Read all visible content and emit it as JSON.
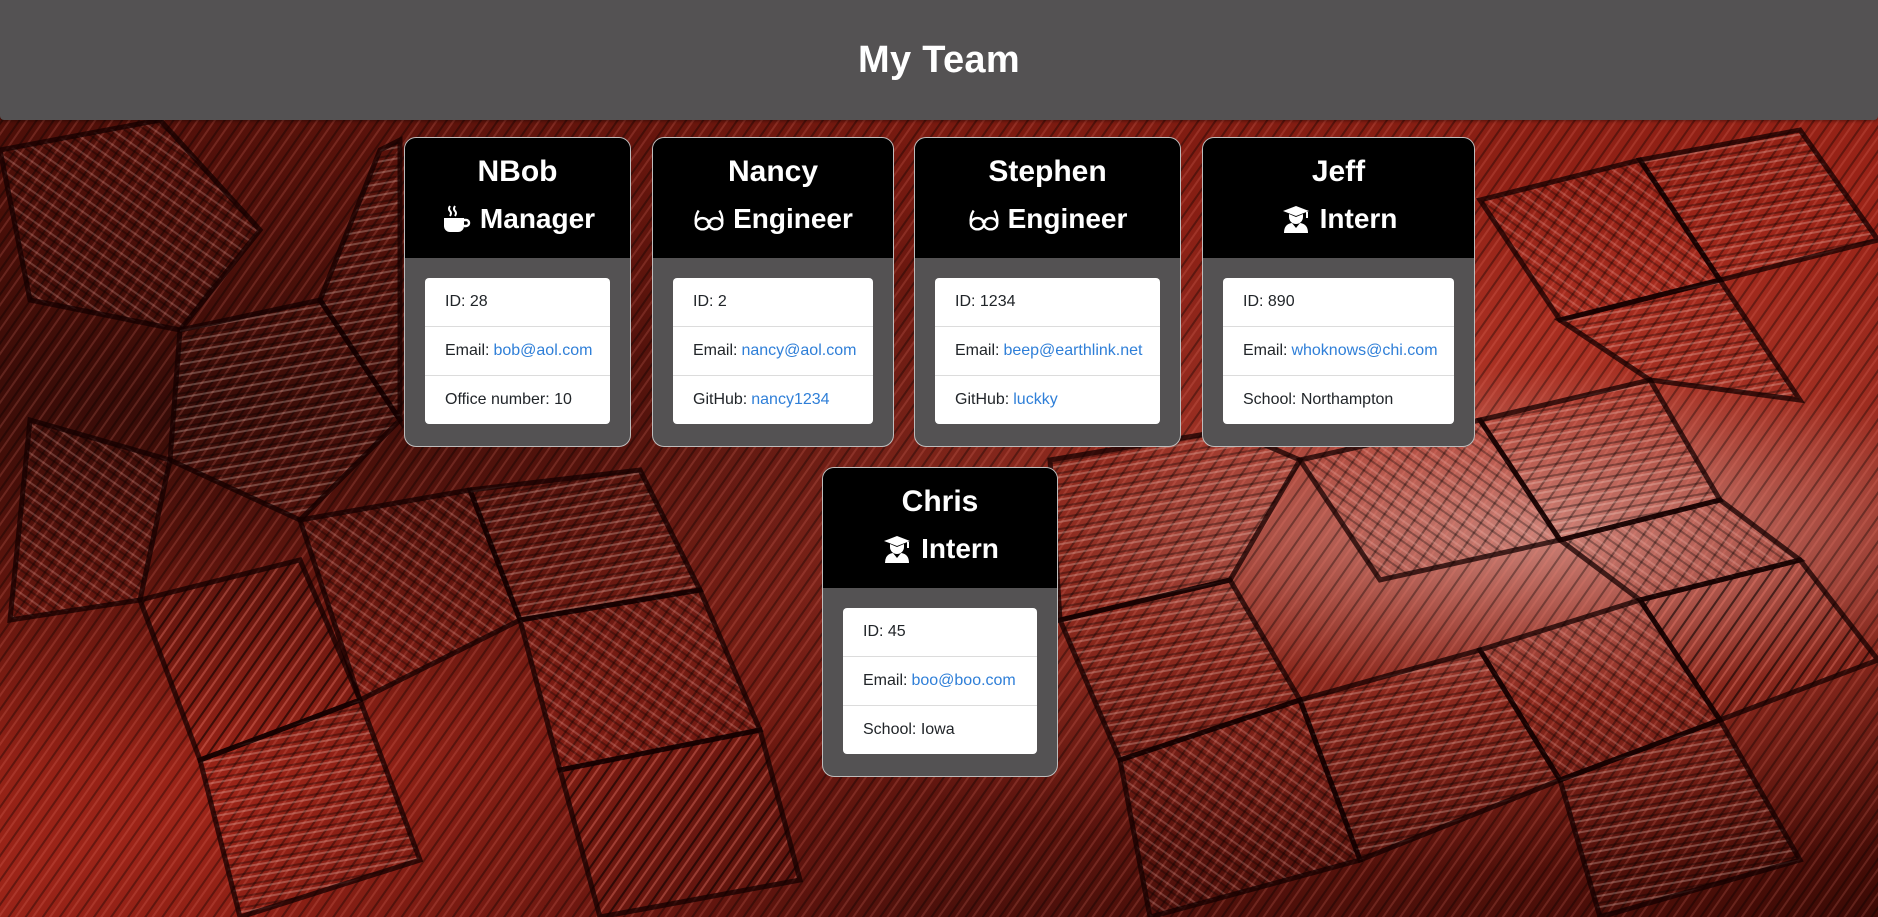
{
  "header": {
    "title": "My Team"
  },
  "colors": {
    "header_bg": "#545253",
    "card_head_bg": "#000000",
    "link": "#2f7fd8",
    "background_accent": "#9c2418"
  },
  "employees": [
    {
      "name": "NBob",
      "role": "Manager",
      "icon": "coffee-icon",
      "id_label": "ID:",
      "id": "28",
      "email_label": "Email:",
      "email": "bob@aol.com",
      "extra_label": "Office number:",
      "extra": "10"
    },
    {
      "name": "Nancy",
      "role": "Engineer",
      "icon": "glasses-icon",
      "id_label": "ID:",
      "id": "2",
      "email_label": "Email:",
      "email": "nancy@aol.com",
      "extra_label": "GitHub:",
      "extra": "nancy1234"
    },
    {
      "name": "Stephen",
      "role": "Engineer",
      "icon": "glasses-icon",
      "id_label": "ID:",
      "id": "1234",
      "email_label": "Email:",
      "email": "beep@earthlink.net",
      "extra_label": "GitHub:",
      "extra": "luckky"
    },
    {
      "name": "Jeff",
      "role": "Intern",
      "icon": "graduate-icon",
      "id_label": "ID:",
      "id": "890",
      "email_label": "Email:",
      "email": "whoknows@chi.com",
      "extra_label": "School:",
      "extra": "Northampton"
    },
    {
      "name": "Chris",
      "role": "Intern",
      "icon": "graduate-icon",
      "id_label": "ID:",
      "id": "45",
      "email_label": "Email:",
      "email": "boo@boo.com",
      "extra_label": "School:",
      "extra": "Iowa"
    }
  ]
}
